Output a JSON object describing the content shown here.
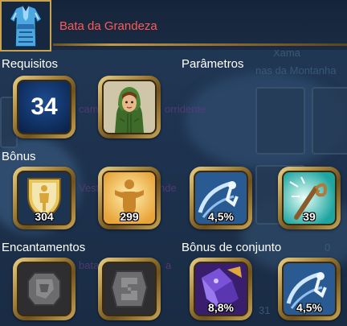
{
  "item": {
    "name": "Bata da Grandeza",
    "icon": "blue-robe-icon"
  },
  "background": {
    "class_text": "Xama",
    "location_text": "nas da Montanha",
    "faded_1": "cam",
    "faded_2": "orridente",
    "faded_3": "Vest",
    "faded_4": "nde",
    "faded_5": "bata",
    "faded_6": "a",
    "faded_num": "0",
    "faded_num2": "31"
  },
  "sections": {
    "requirements": "Requisitos",
    "parameters": "Parâmetros",
    "bonus": "Bônus",
    "enchantments": "Encantamentos",
    "set_bonus": "Bônus de conjunto"
  },
  "requirements": [
    {
      "icon": "level-icon",
      "value": "34"
    },
    {
      "icon": "hooded-character-icon",
      "value": ""
    }
  ],
  "bonus": [
    {
      "icon": "shield-defense-icon",
      "value": "304"
    },
    {
      "icon": "strength-figure-icon",
      "value": "299"
    },
    {
      "icon": "dodge-swirl-icon",
      "value": "4,5%"
    },
    {
      "icon": "magic-swirl-icon",
      "value": "39"
    }
  ],
  "enchantments": [
    {
      "icon": "empty-rune-slot-icon",
      "value": ""
    },
    {
      "icon": "empty-rune-slot-icon",
      "value": ""
    }
  ],
  "set_bonus": [
    {
      "icon": "purple-crystal-icon",
      "value": "8,8%"
    },
    {
      "icon": "dodge-swirl-icon",
      "value": "4,5%"
    }
  ],
  "colors": {
    "item_name": "#ff5a55",
    "frame_gold": "#c9a24d",
    "label": "#ffffff"
  }
}
